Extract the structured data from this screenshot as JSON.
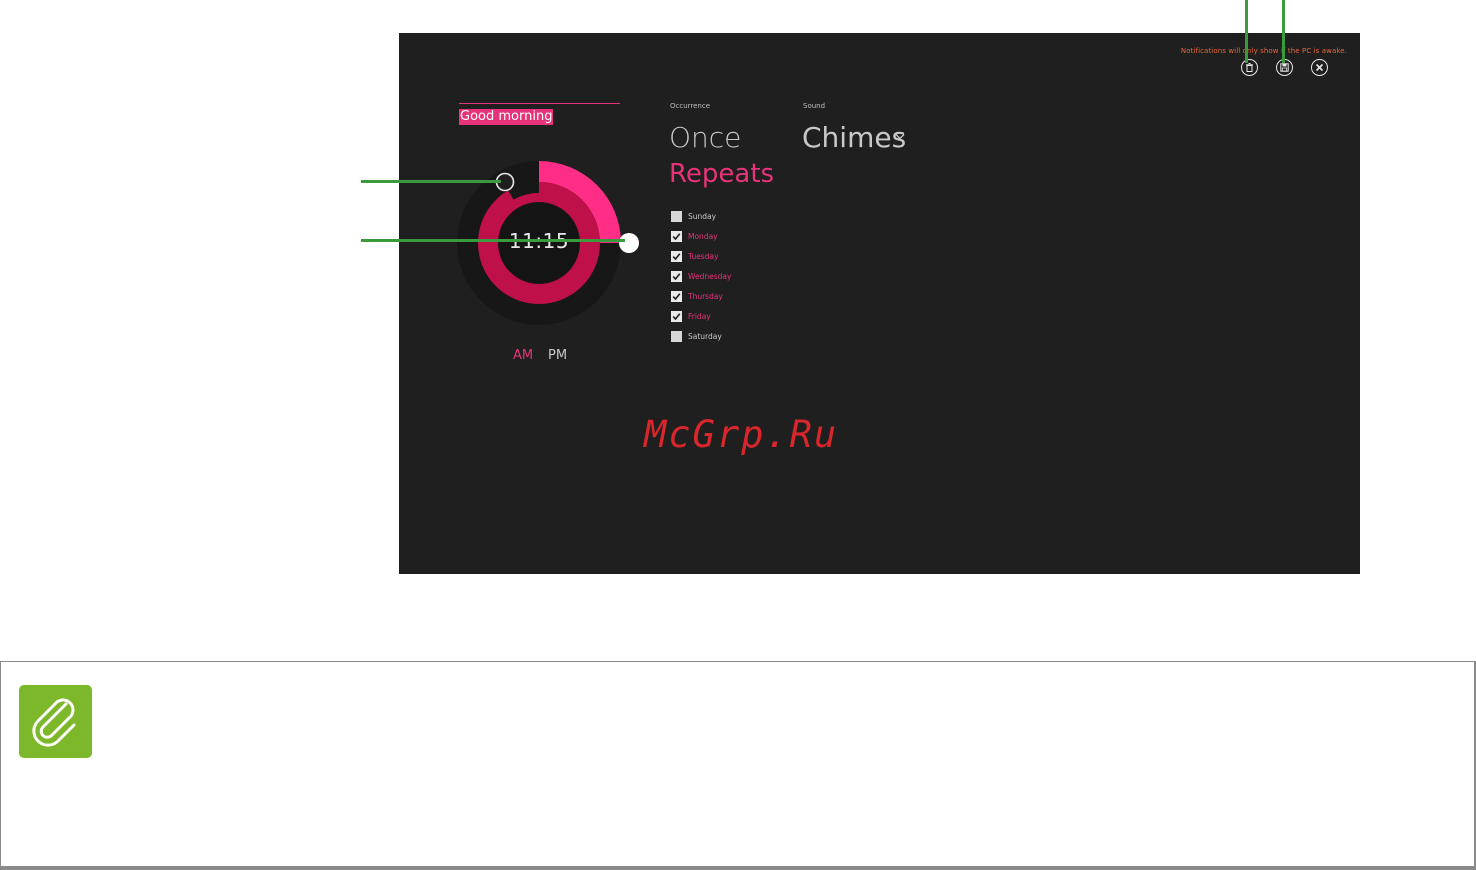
{
  "alarm_screen": {
    "notice": "Notifications will only show if the PC is awake.",
    "toolbar": {
      "delete_icon": "trash-icon",
      "save_icon": "save-icon",
      "close_icon": "close-icon"
    },
    "alarm_name": "Good morning",
    "time": "11:15",
    "am_label": "AM",
    "pm_label": "PM",
    "selected_period": "AM",
    "occurrence": {
      "label": "Occurrence",
      "options": [
        "Once",
        "Repeats"
      ],
      "selected": "Repeats"
    },
    "sound": {
      "label": "Sound",
      "value": "Chimes"
    },
    "days": [
      {
        "label": "Sunday",
        "checked": false
      },
      {
        "label": "Monday",
        "checked": true
      },
      {
        "label": "Tuesday",
        "checked": true
      },
      {
        "label": "Wednesday",
        "checked": true
      },
      {
        "label": "Thursday",
        "checked": true
      },
      {
        "label": "Friday",
        "checked": true
      },
      {
        "label": "Saturday",
        "checked": false
      }
    ]
  },
  "watermark": "McGrp.Ru",
  "colors": {
    "accent": "#e6337a",
    "dark_accent": "#c0104a",
    "background": "#1f1f1f",
    "callout": "#3a9a3e",
    "note_icon": "#7cb829",
    "watermark": "#d8262c"
  },
  "note": {
    "icon": "paperclip-icon"
  }
}
